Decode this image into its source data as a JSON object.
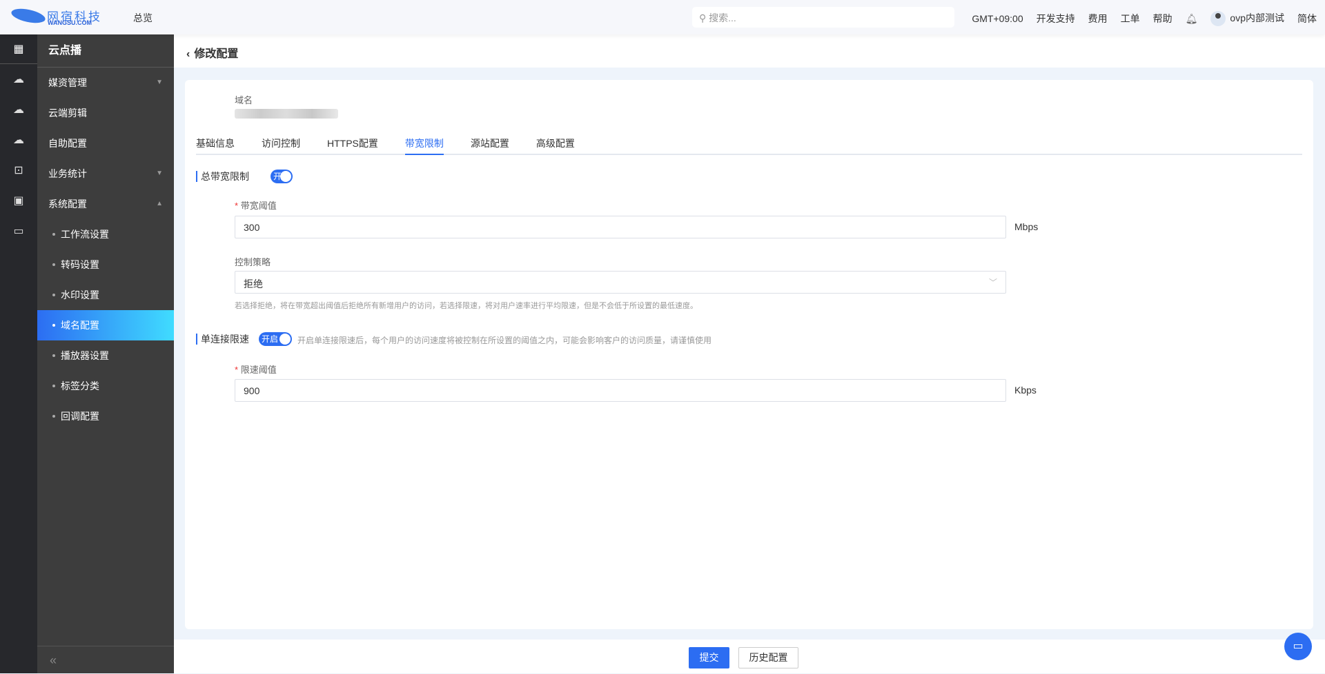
{
  "header": {
    "logo_cn": "网宿科技",
    "logo_en": "WANGSU.COM",
    "overview": "总览",
    "search_placeholder": "搜索...",
    "timezone": "GMT+09:00",
    "dev_support": "开发支持",
    "billing": "费用",
    "tickets": "工单",
    "help": "帮助",
    "user": "ovp内部测试",
    "language": "简体"
  },
  "rail": {
    "icons": [
      "apps-icon",
      "cloud-upload-icon",
      "cloud-play-icon",
      "cloud-shield-icon",
      "settings-box-icon",
      "w-box-icon",
      "ticket-icon"
    ]
  },
  "sidebar": {
    "title": "云点播",
    "items": [
      {
        "label": "媒资管理",
        "arrow": "▼"
      },
      {
        "label": "云端剪辑"
      },
      {
        "label": "自助配置"
      },
      {
        "label": "业务统计",
        "arrow": "▼"
      },
      {
        "label": "系统配置",
        "arrow": "▲"
      },
      {
        "label": "工作流设置"
      },
      {
        "label": "转码设置"
      },
      {
        "label": "水印设置"
      },
      {
        "label": "域名配置",
        "active": true
      },
      {
        "label": "播放器设置"
      },
      {
        "label": "标签分类"
      },
      {
        "label": "回调配置"
      }
    ],
    "collapse": "«"
  },
  "page": {
    "back": "‹",
    "title": "修改配置"
  },
  "form": {
    "domain_label": "域名",
    "tabs": [
      "基础信息",
      "访问控制",
      "HTTPS配置",
      "带宽限制",
      "源站配置",
      "高级配置"
    ],
    "active_tab": "带宽限制",
    "total": {
      "label": "总带宽限制",
      "toggle": "开启",
      "on": true,
      "threshold_label": "带宽阈值",
      "threshold": "300",
      "unit": "Mbps",
      "policy_label": "控制策略",
      "policy": "拒绝",
      "hint": "若选择拒绝，将在带宽超出阈值后拒绝所有新增用户的访问，若选择限速，将对用户速率进行平均限速，但是不会低于所设置的最低速度。"
    },
    "single": {
      "label": "单连接限速",
      "toggle": "开启",
      "on": true,
      "hint": "开启单连接限速后，每个用户的访问速度将被控制在所设置的阈值之内，可能会影响客户的访问质量，请谨慎使用",
      "threshold_label": "限速阈值",
      "threshold": "900",
      "unit": "Kbps"
    },
    "required_mark": "*"
  },
  "footer": {
    "submit": "提交",
    "history": "历史配置"
  },
  "colors": {
    "primary": "#2c6df2",
    "sidebar": "#3d3d3d",
    "rail": "#27282c"
  }
}
